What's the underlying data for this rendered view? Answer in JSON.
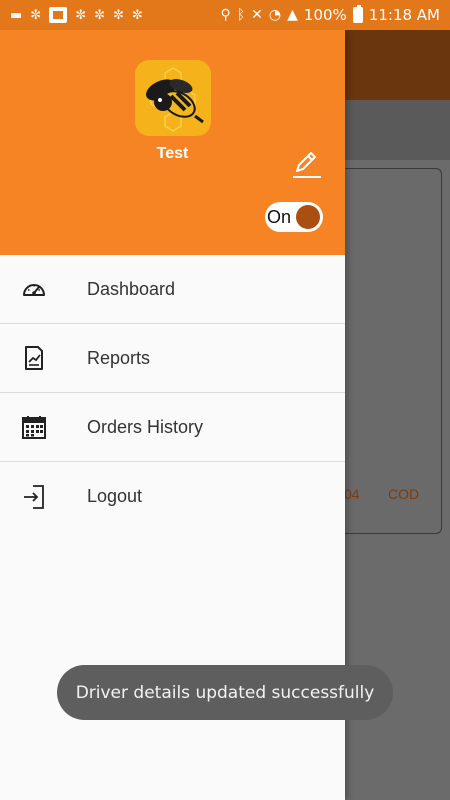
{
  "status_bar": {
    "battery": "100%",
    "time": "11:18 AM"
  },
  "background": {
    "order_id_partial": "04",
    "payment_method": "COD"
  },
  "drawer": {
    "profile": {
      "name": "Test",
      "logo_icon": "bee-logo-icon",
      "edit_icon": "edit-pencil-icon"
    },
    "toggle": {
      "label": "On",
      "state": true
    },
    "menu": [
      {
        "label": "Dashboard",
        "icon": "speedometer-icon"
      },
      {
        "label": "Reports",
        "icon": "report-chart-icon"
      },
      {
        "label": "Orders History",
        "icon": "calendar-icon"
      },
      {
        "label": "Logout",
        "icon": "logout-icon"
      }
    ]
  },
  "toast": {
    "message": "Driver details updated successfully"
  },
  "colors": {
    "header_orange": "#f68424",
    "statusbar_orange": "#e2781a",
    "toggle_knob": "#a94f12"
  }
}
